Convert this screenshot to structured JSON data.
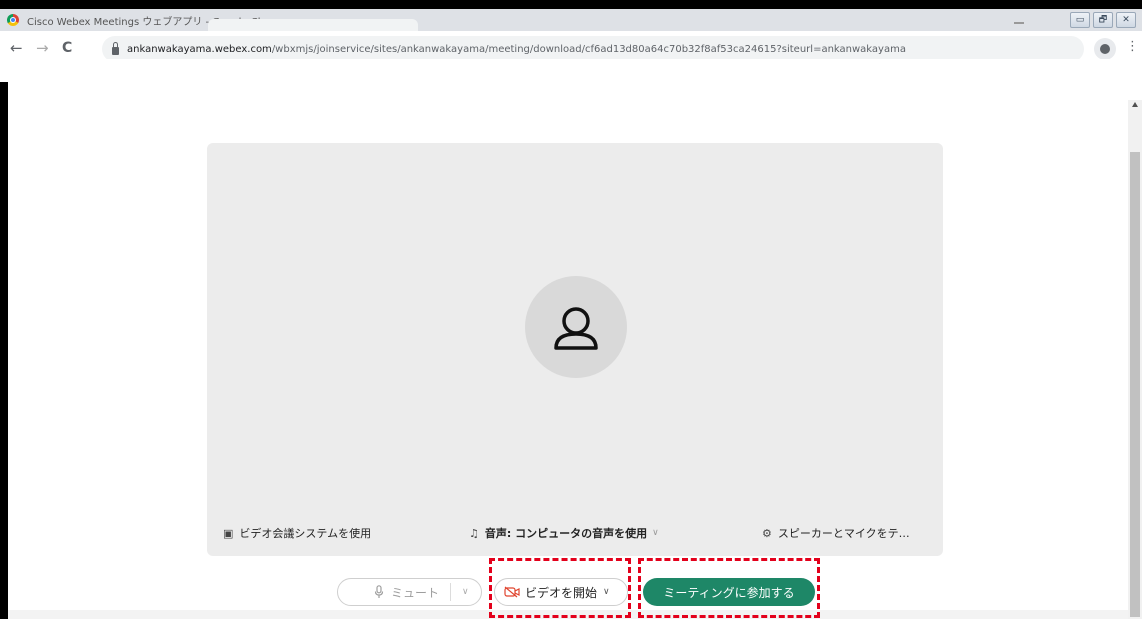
{
  "browser": {
    "window_title": "Cisco Webex Meetings ウェブアプリ - Google Chrome",
    "url_host": "ankanwakayama.webex.com",
    "url_path": "/wbxmjs/joinservice/sites/ankanwakayama/meeting/download/cf6ad13d80a64c70b32f8af53ca24615?siteurl=ankanwakayama",
    "back_icon": "←",
    "forward_icon": "→",
    "reload_icon": "C",
    "menu_icon": "⋮",
    "window_controls": [
      "▭",
      "🗗",
      "✕"
    ]
  },
  "preview": {
    "avatar_icon": "person-outline-icon",
    "options": {
      "video_system": {
        "icon": "▣",
        "label": "ビデオ会議システムを使用"
      },
      "audio": {
        "icon": "♫",
        "label": "音声: コンピュータの音声を使用",
        "chevron": "∨"
      },
      "speaker_mic": {
        "icon": "⚙",
        "label": "スピーカーとマイクをテ…"
      }
    }
  },
  "controls": {
    "mute": {
      "icon": "mic-icon",
      "label": "ミュート",
      "chevron": "∨"
    },
    "video": {
      "icon": "video-off-icon",
      "label": "ビデオを開始",
      "chevron": "∨"
    },
    "join": {
      "label": "ミーティングに参加する"
    }
  },
  "colors": {
    "join_button": "#1e8767",
    "highlight": "#e3001b",
    "video_off_icon": "#e0442e"
  }
}
